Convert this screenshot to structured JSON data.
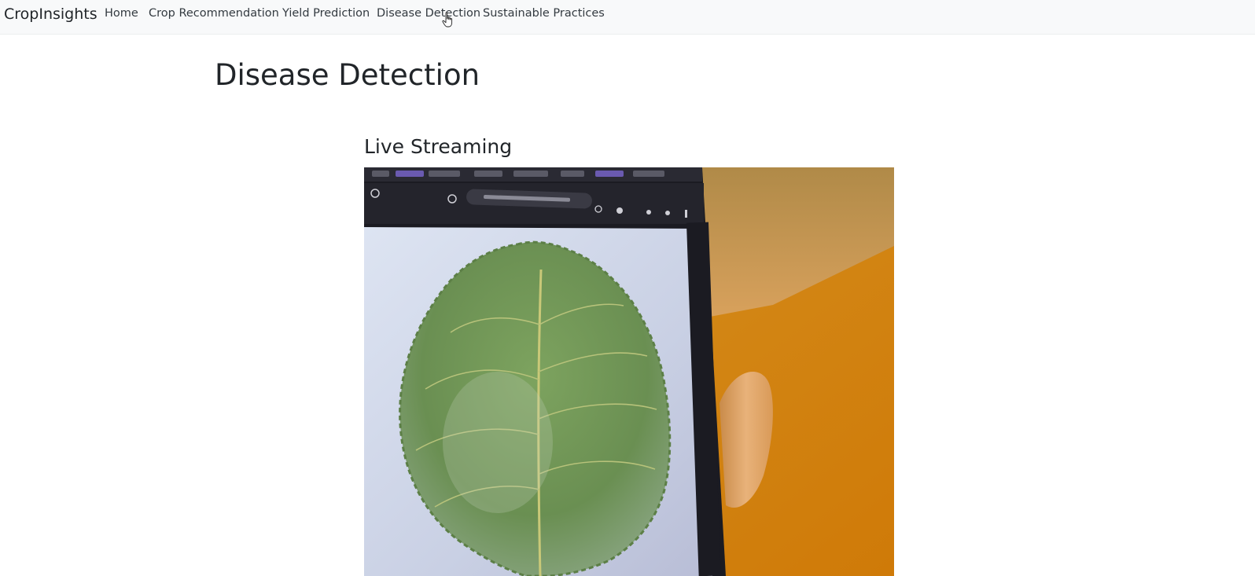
{
  "navbar": {
    "brand": "CropInsights",
    "links": [
      {
        "label": "Home"
      },
      {
        "label": "Crop Recommendation"
      },
      {
        "label": "Yield Prediction"
      },
      {
        "label": "Disease Detection"
      },
      {
        "label": "Sustainable Practices"
      }
    ],
    "active_link": "Disease Detection"
  },
  "main": {
    "page_title": "Disease Detection",
    "section_title": "Live Streaming",
    "stream": {
      "icon": "camera-feed-image",
      "depicts": "phone-screen-leaf"
    }
  },
  "colors": {
    "navbar_bg": "#f8f9fa",
    "text": "#212529",
    "wall_orange": "#d3830f",
    "leaf_green": "#6e9356"
  }
}
